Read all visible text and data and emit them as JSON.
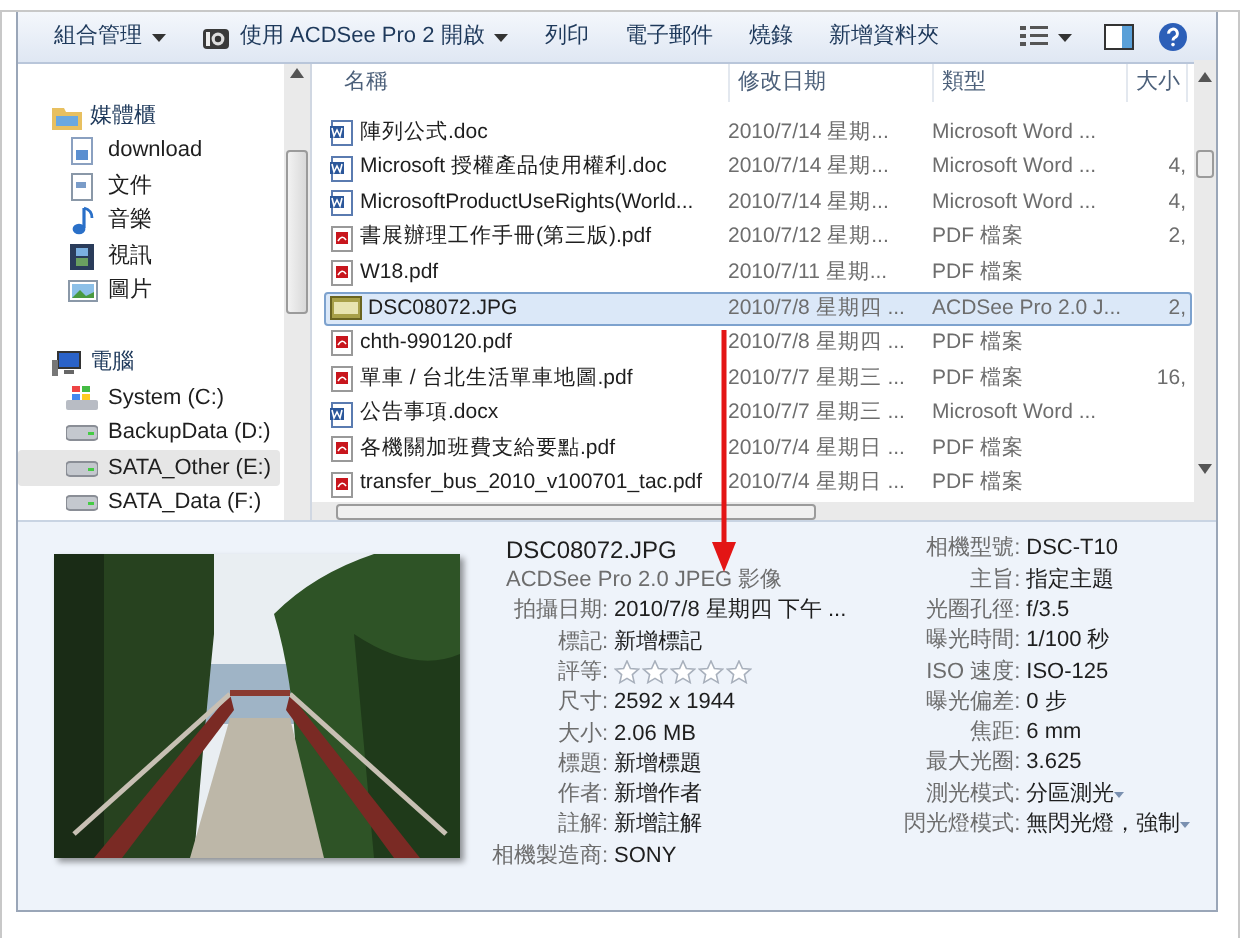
{
  "toolbar": [
    {
      "label": "組合管理",
      "kind": "menu"
    },
    {
      "label": "使用 ACDSee Pro 2 開啟",
      "kind": "app"
    },
    {
      "label": "列印",
      "kind": "plain"
    },
    {
      "label": "電子郵件",
      "kind": "plain"
    },
    {
      "label": "燒錄",
      "kind": "plain"
    },
    {
      "label": "新增資料夾",
      "kind": "plain"
    }
  ],
  "navigation": [
    {
      "label": "媒體櫃",
      "kind": "library",
      "children": [
        {
          "label": "download",
          "kind": "download",
          "selected": false
        },
        {
          "label": "文件",
          "kind": "documents",
          "selected": false
        },
        {
          "label": "音樂",
          "kind": "music",
          "selected": false
        },
        {
          "label": "視訊",
          "kind": "video",
          "selected": false
        },
        {
          "label": "圖片",
          "kind": "pictures",
          "selected": false
        }
      ]
    },
    {
      "label": "電腦",
      "kind": "computer",
      "children": [
        {
          "label": "System (C:)",
          "kind": "system",
          "selected": false
        },
        {
          "label": "BackupData (D:)",
          "kind": "drive",
          "selected": false
        },
        {
          "label": "SATA_Other (E:)",
          "kind": "drive",
          "selected": true
        },
        {
          "label": "SATA_Data (F:)",
          "kind": "drive",
          "selected": false
        }
      ]
    }
  ],
  "file_list": {
    "columns": [
      "名稱",
      "修改日期",
      "類型",
      "大小"
    ],
    "rows": [
      {
        "name": "陣列公式.doc",
        "date": "2010/7/14 星期...",
        "type": "Microsoft Word ...",
        "kind": "word",
        "selected": false
      },
      {
        "name": "Microsoft 授權產品使用權利.doc",
        "date": "2010/7/14 星期...",
        "type": "Microsoft Word ...",
        "size": "4,",
        "kind": "word",
        "selected": false
      },
      {
        "name": "MicrosoftProductUseRights(World...",
        "date": "2010/7/14 星期...",
        "type": "Microsoft Word ...",
        "size": "4,",
        "kind": "word",
        "selected": false
      },
      {
        "name": "書展辦理工作手冊(第三版).pdf",
        "date": "2010/7/12 星期...",
        "type": "PDF 檔案",
        "size": "2,",
        "kind": "pdf",
        "selected": false
      },
      {
        "name": "W18.pdf",
        "date": "2010/7/11 星期...",
        "type": "PDF 檔案",
        "kind": "pdf",
        "selected": false
      },
      {
        "name": "DSC08072.JPG",
        "date": "2010/7/8 星期四 ...",
        "type": "ACDSee Pro 2.0 J...",
        "size": "2,",
        "kind": "jpg",
        "selected": true
      },
      {
        "name": "chth-990120.pdf",
        "date": "2010/7/8 星期四 ...",
        "type": "PDF 檔案",
        "kind": "pdf",
        "selected": false
      },
      {
        "name": "單車 / 台北生活單車地圖.pdf",
        "date": "2010/7/7 星期三 ...",
        "type": "PDF 檔案",
        "size": "16,",
        "kind": "pdf",
        "selected": false
      },
      {
        "name": "公告事項.docx",
        "date": "2010/7/7 星期三 ...",
        "type": "Microsoft Word ...",
        "kind": "word",
        "selected": false
      },
      {
        "name": "各機關加班費支給要點.pdf",
        "date": "2010/7/4 星期日 ...",
        "type": "PDF 檔案",
        "kind": "pdf",
        "selected": false
      },
      {
        "name": "transfer_bus_2010_v100701_tac.pdf",
        "date": "2010/7/4 星期日 ...",
        "type": "PDF 檔案",
        "kind": "pdf",
        "selected": false
      }
    ]
  },
  "details": {
    "title": "DSC08072.JPG",
    "subtitle": "ACDSee Pro 2.0 JPEG 影像",
    "left_fields": [
      {
        "label": "拍攝日期:",
        "value": "2010/7/8 星期四 下午 ...",
        "kind": "text"
      },
      {
        "label": "標記:",
        "value": "新增標記",
        "kind": "text"
      },
      {
        "label": "評等:",
        "kind": "stars",
        "stars": 0
      },
      {
        "label": "尺寸:",
        "value": "2592 x 1944",
        "kind": "text"
      },
      {
        "label": "大小:",
        "value": "2.06 MB",
        "kind": "text"
      },
      {
        "label": "標題:",
        "value": "新增標題",
        "kind": "text"
      },
      {
        "label": "作者:",
        "value": "新增作者",
        "kind": "text"
      },
      {
        "label": "註解:",
        "value": "新增註解",
        "kind": "text"
      },
      {
        "label": "相機製造商:",
        "value": "SONY",
        "kind": "text"
      }
    ],
    "right_fields": [
      {
        "label": "相機型號:",
        "value": "DSC-T10",
        "dropdown": false
      },
      {
        "label": "主旨:",
        "value": "指定主題",
        "dropdown": false
      },
      {
        "label": "光圈孔徑:",
        "value": "f/3.5",
        "dropdown": false
      },
      {
        "label": "曝光時間:",
        "value": "1/100 秒",
        "dropdown": false
      },
      {
        "label": "ISO 速度:",
        "value": "ISO-125",
        "dropdown": false
      },
      {
        "label": "曝光偏差:",
        "value": "0 步",
        "dropdown": false
      },
      {
        "label": "焦距:",
        "value": "6 mm",
        "dropdown": false
      },
      {
        "label": "最大光圈:",
        "value": "3.625",
        "dropdown": false
      },
      {
        "label": "測光模式:",
        "value": "分區測光",
        "dropdown": true
      },
      {
        "label": "閃光燈模式:",
        "value": "無閃光燈，強制",
        "dropdown": true
      }
    ]
  }
}
